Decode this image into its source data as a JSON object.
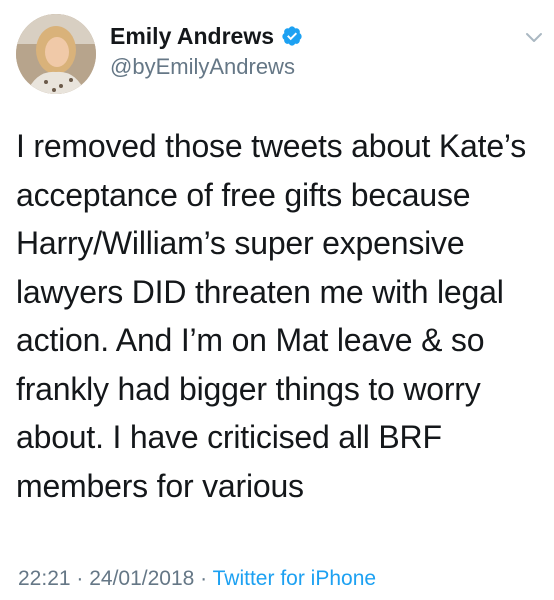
{
  "tweet": {
    "display_name": "Emily Andrews",
    "handle": "@byEmilyAndrews",
    "verified": true,
    "text": "I removed those tweets about Kate’s\nacceptance of free gifts because\nHarry/William’s super expensive\nlawyers DID threaten me with legal\naction. And I’m on Mat leave & so\nfrankly had bigger things to worry\nabout. I have criticised all BRF\nmembers for various",
    "time": "22:21",
    "separator_1": " · ",
    "date": "24/01/2018",
    "separator_2": " · ",
    "source": "Twitter for iPhone"
  },
  "icons": {
    "verified": "verified-badge-icon",
    "menu": "chevron-down-icon"
  },
  "colors": {
    "text": "#14171a",
    "secondary": "#657786",
    "accent": "#1da1f2"
  }
}
